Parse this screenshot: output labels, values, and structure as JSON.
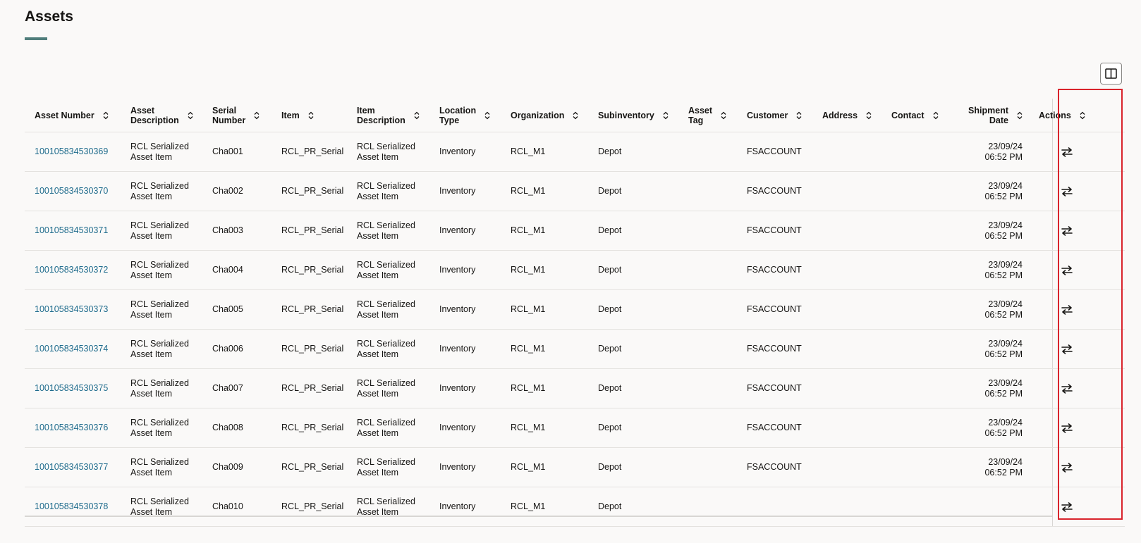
{
  "page": {
    "title": "Assets"
  },
  "toolbar": {
    "column_toggle_icon": "columns-icon"
  },
  "colors": {
    "accent_underline": "#4f7d7b",
    "link": "#1e6b8c",
    "highlight": "#d9242c"
  },
  "table": {
    "columns": [
      {
        "key": "asset_number",
        "label": "Asset Number"
      },
      {
        "key": "asset_description",
        "label": "Asset\nDescription"
      },
      {
        "key": "serial_number",
        "label": "Serial\nNumber"
      },
      {
        "key": "item",
        "label": "Item"
      },
      {
        "key": "item_description",
        "label": "Item\nDescription"
      },
      {
        "key": "location_type",
        "label": "Location\nType"
      },
      {
        "key": "organization",
        "label": "Organization"
      },
      {
        "key": "subinventory",
        "label": "Subinventory"
      },
      {
        "key": "asset_tag",
        "label": "Asset\nTag"
      },
      {
        "key": "customer",
        "label": "Customer"
      },
      {
        "key": "address",
        "label": "Address"
      },
      {
        "key": "contact",
        "label": "Contact"
      },
      {
        "key": "shipment_date",
        "label": "Shipment\nDate"
      },
      {
        "key": "actions",
        "label": "Actions"
      }
    ],
    "rows": [
      {
        "asset_number": "100105834530369",
        "asset_description": "RCL Serialized\nAsset Item",
        "serial_number": "Cha001",
        "item": "RCL_PR_Serial",
        "item_description": "RCL Serialized\nAsset Item",
        "location_type": "Inventory",
        "organization": "RCL_M1",
        "subinventory": "Depot",
        "asset_tag": "",
        "customer": "FSACCOUNT",
        "address": "",
        "contact": "",
        "shipment_date": "23/09/24\n06:52 PM"
      },
      {
        "asset_number": "100105834530370",
        "asset_description": "RCL Serialized\nAsset Item",
        "serial_number": "Cha002",
        "item": "RCL_PR_Serial",
        "item_description": "RCL Serialized\nAsset Item",
        "location_type": "Inventory",
        "organization": "RCL_M1",
        "subinventory": "Depot",
        "asset_tag": "",
        "customer": "FSACCOUNT",
        "address": "",
        "contact": "",
        "shipment_date": "23/09/24\n06:52 PM"
      },
      {
        "asset_number": "100105834530371",
        "asset_description": "RCL Serialized\nAsset Item",
        "serial_number": "Cha003",
        "item": "RCL_PR_Serial",
        "item_description": "RCL Serialized\nAsset Item",
        "location_type": "Inventory",
        "organization": "RCL_M1",
        "subinventory": "Depot",
        "asset_tag": "",
        "customer": "FSACCOUNT",
        "address": "",
        "contact": "",
        "shipment_date": "23/09/24\n06:52 PM"
      },
      {
        "asset_number": "100105834530372",
        "asset_description": "RCL Serialized\nAsset Item",
        "serial_number": "Cha004",
        "item": "RCL_PR_Serial",
        "item_description": "RCL Serialized\nAsset Item",
        "location_type": "Inventory",
        "organization": "RCL_M1",
        "subinventory": "Depot",
        "asset_tag": "",
        "customer": "FSACCOUNT",
        "address": "",
        "contact": "",
        "shipment_date": "23/09/24\n06:52 PM"
      },
      {
        "asset_number": "100105834530373",
        "asset_description": "RCL Serialized\nAsset Item",
        "serial_number": "Cha005",
        "item": "RCL_PR_Serial",
        "item_description": "RCL Serialized\nAsset Item",
        "location_type": "Inventory",
        "organization": "RCL_M1",
        "subinventory": "Depot",
        "asset_tag": "",
        "customer": "FSACCOUNT",
        "address": "",
        "contact": "",
        "shipment_date": "23/09/24\n06:52 PM"
      },
      {
        "asset_number": "100105834530374",
        "asset_description": "RCL Serialized\nAsset Item",
        "serial_number": "Cha006",
        "item": "RCL_PR_Serial",
        "item_description": "RCL Serialized\nAsset Item",
        "location_type": "Inventory",
        "organization": "RCL_M1",
        "subinventory": "Depot",
        "asset_tag": "",
        "customer": "FSACCOUNT",
        "address": "",
        "contact": "",
        "shipment_date": "23/09/24\n06:52 PM"
      },
      {
        "asset_number": "100105834530375",
        "asset_description": "RCL Serialized\nAsset Item",
        "serial_number": "Cha007",
        "item": "RCL_PR_Serial",
        "item_description": "RCL Serialized\nAsset Item",
        "location_type": "Inventory",
        "organization": "RCL_M1",
        "subinventory": "Depot",
        "asset_tag": "",
        "customer": "FSACCOUNT",
        "address": "",
        "contact": "",
        "shipment_date": "23/09/24\n06:52 PM"
      },
      {
        "asset_number": "100105834530376",
        "asset_description": "RCL Serialized\nAsset Item",
        "serial_number": "Cha008",
        "item": "RCL_PR_Serial",
        "item_description": "RCL Serialized\nAsset Item",
        "location_type": "Inventory",
        "organization": "RCL_M1",
        "subinventory": "Depot",
        "asset_tag": "",
        "customer": "FSACCOUNT",
        "address": "",
        "contact": "",
        "shipment_date": "23/09/24\n06:52 PM"
      },
      {
        "asset_number": "100105834530377",
        "asset_description": "RCL Serialized\nAsset Item",
        "serial_number": "Cha009",
        "item": "RCL_PR_Serial",
        "item_description": "RCL Serialized\nAsset Item",
        "location_type": "Inventory",
        "organization": "RCL_M1",
        "subinventory": "Depot",
        "asset_tag": "",
        "customer": "FSACCOUNT",
        "address": "",
        "contact": "",
        "shipment_date": "23/09/24\n06:52 PM"
      },
      {
        "asset_number": "100105834530378",
        "asset_description": "RCL Serialized\nAsset Item",
        "serial_number": "Cha010",
        "item": "RCL_PR_Serial",
        "item_description": "RCL Serialized\nAsset Item",
        "location_type": "Inventory",
        "organization": "RCL_M1",
        "subinventory": "Depot",
        "asset_tag": "",
        "customer": "",
        "address": "",
        "contact": "",
        "shipment_date": ""
      }
    ],
    "row_action_icon": "swap-arrows-icon",
    "sort_icon": "sort-icon"
  }
}
